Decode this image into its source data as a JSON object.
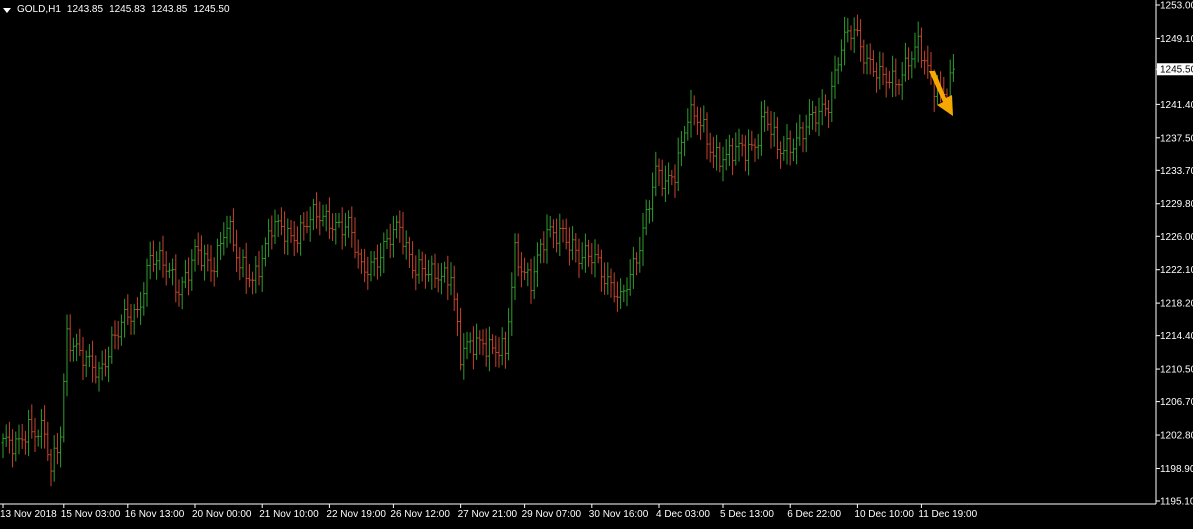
{
  "header": {
    "symbol": "GOLD,H1",
    "ohlc_open": "1243.85",
    "ohlc_high": "1245.83",
    "ohlc_low": "1243.85",
    "ohlc_close": "1245.50"
  },
  "colors": {
    "background": "#000000",
    "frame": "#ffffff",
    "bull": "#2e9e2e",
    "bear": "#c8452c",
    "price_marker_bg": "#ffffff",
    "arrow": "#f5a800"
  },
  "icons": {
    "header": "dropdown-triangle-icon",
    "annotation": "down-arrow-icon"
  },
  "chart_data": {
    "type": "candlestick",
    "symbol": "GOLD",
    "timeframe": "H1",
    "current_price": "1245.50",
    "ylim": [
      1195.1,
      1253.0
    ],
    "y_ticks": [
      "1253.00",
      "1249.10",
      "1245.50",
      "1241.40",
      "1237.50",
      "1233.70",
      "1229.80",
      "1226.00",
      "1222.10",
      "1218.20",
      "1214.40",
      "1210.50",
      "1206.70",
      "1202.80",
      "1198.90",
      "1195.10"
    ],
    "x_ticks": [
      "13 Nov 2018",
      "15 Nov 03:00",
      "16 Nov 13:00",
      "20 Nov 00:00",
      "21 Nov 10:00",
      "22 Nov 19:00",
      "26 Nov 12:00",
      "27 Nov 21:00",
      "29 Nov 07:00",
      "30 Nov 16:00",
      "4 Dec 03:00",
      "5 Dec 13:00",
      "6 Dec 22:00",
      "10 Dec 10:00",
      "11 Dec 19:00"
    ],
    "x_tick_bar_index": [
      0,
      19,
      39,
      60,
      81,
      102,
      122,
      143,
      163,
      184,
      205,
      225,
      246,
      267,
      287
    ],
    "price_path": [
      [
        0,
        1202
      ],
      [
        4,
        1201
      ],
      [
        8,
        1204
      ],
      [
        13,
        1203
      ],
      [
        15,
        1198
      ],
      [
        18,
        1203
      ],
      [
        20,
        1215
      ],
      [
        26,
        1211
      ],
      [
        30,
        1210
      ],
      [
        34,
        1214
      ],
      [
        38,
        1216
      ],
      [
        42,
        1217
      ],
      [
        46,
        1224
      ],
      [
        51,
        1222
      ],
      [
        55,
        1220
      ],
      [
        60,
        1224
      ],
      [
        65,
        1222
      ],
      [
        70,
        1228
      ],
      [
        74,
        1222
      ],
      [
        78,
        1221
      ],
      [
        84,
        1227
      ],
      [
        90,
        1226
      ],
      [
        96,
        1228
      ],
      [
        102,
        1228
      ],
      [
        108,
        1227
      ],
      [
        112,
        1222
      ],
      [
        118,
        1224
      ],
      [
        124,
        1227
      ],
      [
        128,
        1223
      ],
      [
        134,
        1221
      ],
      [
        140,
        1222
      ],
      [
        143,
        1212
      ],
      [
        150,
        1214
      ],
      [
        157,
        1212
      ],
      [
        160,
        1224
      ],
      [
        165,
        1221
      ],
      [
        170,
        1226
      ],
      [
        175,
        1227
      ],
      [
        180,
        1223
      ],
      [
        185,
        1224
      ],
      [
        190,
        1220
      ],
      [
        193,
        1218
      ],
      [
        198,
        1224
      ],
      [
        204,
        1233
      ],
      [
        207,
        1232
      ],
      [
        210,
        1234
      ],
      [
        214,
        1240
      ],
      [
        218,
        1239
      ],
      [
        222,
        1236
      ],
      [
        226,
        1235
      ],
      [
        230,
        1236
      ],
      [
        235,
        1237
      ],
      [
        238,
        1240
      ],
      [
        242,
        1236
      ],
      [
        246,
        1237
      ],
      [
        250,
        1238
      ],
      [
        254,
        1240
      ],
      [
        258,
        1242
      ],
      [
        262,
        1248
      ],
      [
        266,
        1250
      ],
      [
        270,
        1247
      ],
      [
        275,
        1244
      ],
      [
        279,
        1244
      ],
      [
        283,
        1247
      ],
      [
        286,
        1248
      ],
      [
        290,
        1244
      ],
      [
        294,
        1243
      ],
      [
        297,
        1245
      ]
    ],
    "annotation": {
      "type": "arrow",
      "direction": "down"
    }
  }
}
